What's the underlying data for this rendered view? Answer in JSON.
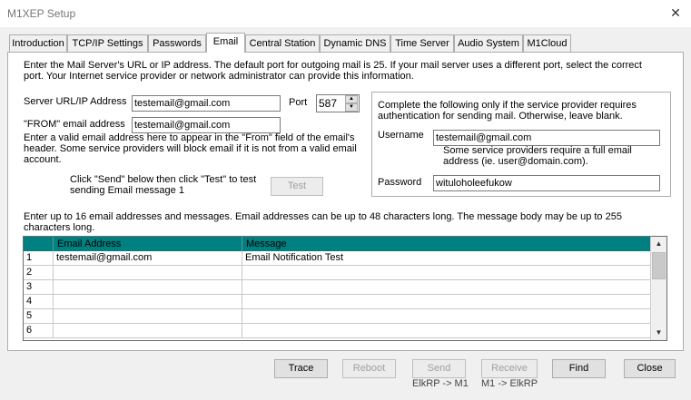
{
  "window": {
    "title": "M1XEP Setup",
    "close_glyph": "✕"
  },
  "tabs": [
    {
      "label": "Introduction"
    },
    {
      "label": "TCP/IP Settings"
    },
    {
      "label": "Passwords"
    },
    {
      "label": "Email"
    },
    {
      "label": "Central Station"
    },
    {
      "label": "Dynamic DNS"
    },
    {
      "label": "Time Server"
    },
    {
      "label": "Audio System"
    },
    {
      "label": "M1Cloud"
    }
  ],
  "active_tab": "Email",
  "intro": {
    "line1": "Enter the Mail Server's URL or IP address.  The default port for outgoing mail is 25.  If your mail server uses a different port, select the correct",
    "line2": "port.  Your Internet service provider or network administrator can provide this information."
  },
  "server": {
    "label": "Server URL/IP Address",
    "value": "testemail@gmail.com",
    "port_label": "Port",
    "port_value": "587"
  },
  "from": {
    "label": "\"FROM\" email address",
    "value": "testemail@gmail.com",
    "help1": "Enter a valid email address here to appear in the \"From\" field of the email's",
    "help2": "header. Some service providers will block email if it is not from a valid email",
    "help3": "account."
  },
  "test": {
    "hint1": "Click \"Send\" below then click \"Test\" to test",
    "hint2": "sending Email message 1",
    "button_label": "Test"
  },
  "auth": {
    "line1": "Complete the following only if the service provider requires",
    "line2": "authentication for sending mail.  Otherwise, leave blank.",
    "username_label": "Username",
    "username_value": "testemail@gmail.com",
    "username_help1": "Some service providers require a full email",
    "username_help2": "address (ie. user@domain.com).",
    "password_label": "Password",
    "password_value": "wituloholeefukow"
  },
  "messages": {
    "info1": "Enter up to 16 email addresses and messages.  Email addresses can be up to 48 characters long.  The message body may be up to 255",
    "info2": "characters long.",
    "columns": [
      "Email Address",
      "Message"
    ],
    "rows": [
      {
        "num": "1",
        "email": "testemail@gmail.com",
        "message": "Email Notification Test"
      },
      {
        "num": "2",
        "email": "",
        "message": ""
      },
      {
        "num": "3",
        "email": "",
        "message": ""
      },
      {
        "num": "4",
        "email": "",
        "message": ""
      },
      {
        "num": "5",
        "email": "",
        "message": ""
      },
      {
        "num": "6",
        "email": "",
        "message": ""
      }
    ]
  },
  "footer": {
    "trace": "Trace",
    "reboot": "Reboot",
    "send": "Send",
    "send_caption": "ElkRP -> M1",
    "receive": "Receive",
    "receive_caption": "M1 -> ElkRP",
    "find": "Find",
    "close": "Close"
  },
  "icons": {
    "scroll_up": "▲",
    "scroll_down": "▼",
    "spin_up": "▲",
    "spin_down": "▼"
  },
  "colors": {
    "grid_header": "#008080",
    "window_bg": "#f0f0f0"
  }
}
